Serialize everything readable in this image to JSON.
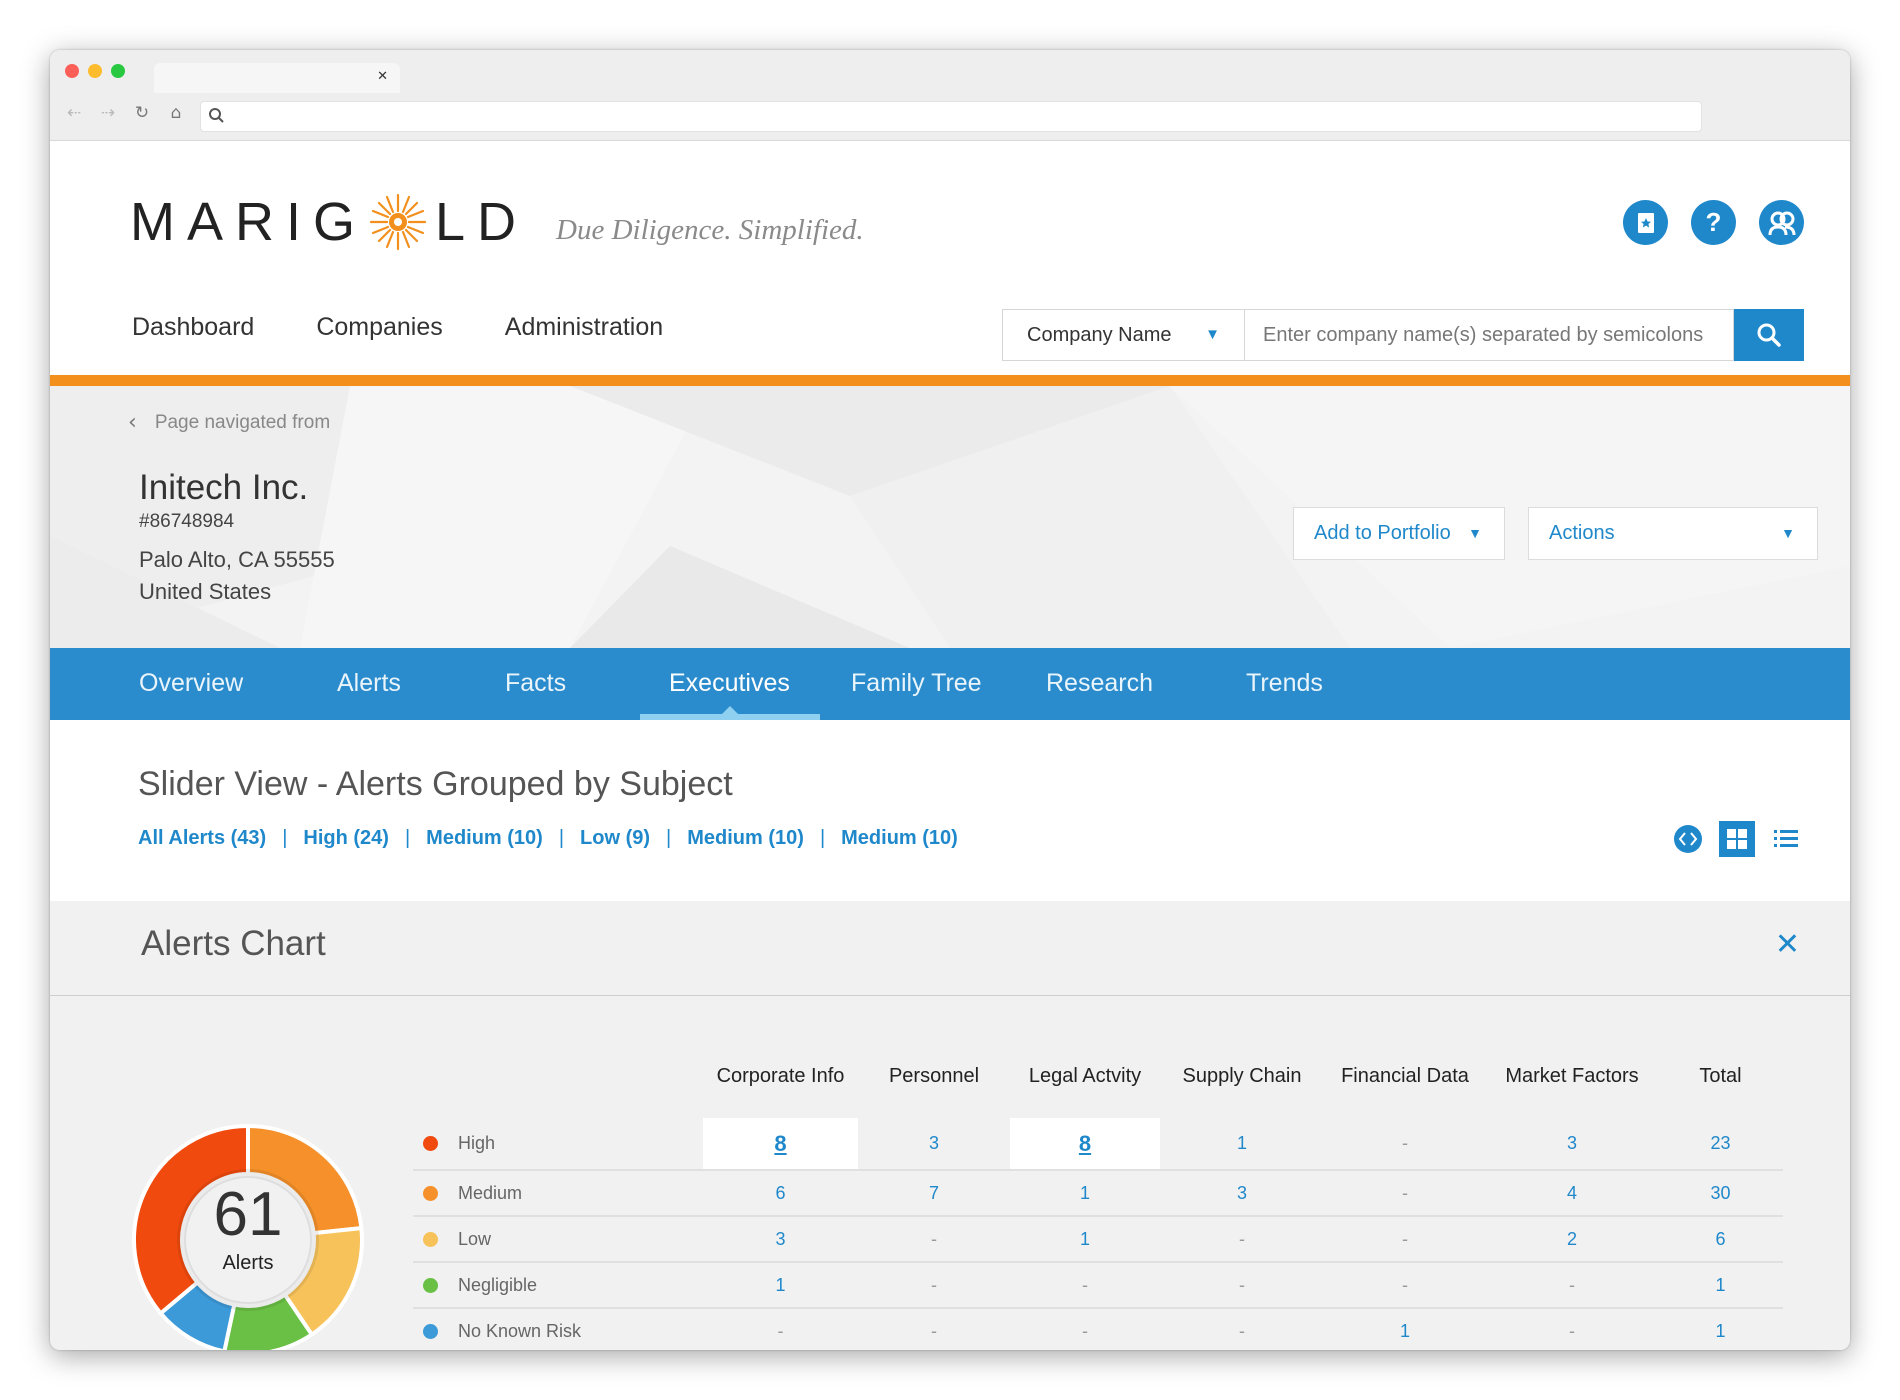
{
  "brand": {
    "logo_text_left": "MARIG",
    "logo_text_right": "LD",
    "tagline": "Due Diligence. Simplified."
  },
  "nav": [
    "Dashboard",
    "Companies",
    "Administration"
  ],
  "search": {
    "type": "Company Name",
    "placeholder": "Enter company name(s) separated by semicolons"
  },
  "company": {
    "back": "Page navigated from",
    "name": "Initech Inc.",
    "id": "#86748984",
    "address1": "Palo Alto, CA 55555",
    "address2": "United States",
    "add_portfolio": "Add to Portfolio",
    "actions": "Actions"
  },
  "tabs": [
    "Overview",
    "Alerts",
    "Facts",
    "Executives",
    "Family Tree",
    "Research",
    "Trends"
  ],
  "active_tab": "Executives",
  "section": {
    "title": "Slider View - Alerts Grouped by Subject",
    "filters": [
      "All Alerts (43)",
      "High (24)",
      "Medium (10)",
      "Low (9)",
      "Medium (10)",
      "Medium (10)"
    ]
  },
  "chart_panel": {
    "title": "Alerts Chart",
    "total": "61",
    "total_label": "Alerts"
  },
  "colors": {
    "accent": "#1f88cb",
    "brand_orange": "#f3901d",
    "high": "#f04a0e",
    "medium": "#f5902a",
    "low": "#f7c25a",
    "negligible": "#6abf45",
    "no_known_risk": "#3d9ad8"
  },
  "chart_data": {
    "type": "table",
    "columns": [
      "Corporate Info",
      "Personnel",
      "Legal Actvity",
      "Supply Chain",
      "Financial Data",
      "Market Factors",
      "Total"
    ],
    "rows": [
      {
        "name": "High",
        "values": [
          "8",
          "3",
          "8",
          "1",
          "-",
          "3",
          "23"
        ]
      },
      {
        "name": "Medium",
        "values": [
          "6",
          "7",
          "1",
          "3",
          "-",
          "4",
          "30"
        ]
      },
      {
        "name": "Low",
        "values": [
          "3",
          "-",
          "1",
          "-",
          "-",
          "2",
          "6"
        ]
      },
      {
        "name": "Negligible",
        "values": [
          "1",
          "-",
          "-",
          "-",
          "-",
          "-",
          "1"
        ]
      },
      {
        "name": "No Known Risk",
        "values": [
          "-",
          "-",
          "-",
          "-",
          "1",
          "-",
          "1"
        ]
      }
    ],
    "donut": {
      "type": "pie",
      "total": 61,
      "slices": [
        {
          "name": "High",
          "value": 23
        },
        {
          "name": "Medium",
          "value": 30
        },
        {
          "name": "Low",
          "value": 6
        },
        {
          "name": "Negligible",
          "value": 1
        },
        {
          "name": "No Known Risk",
          "value": 1
        }
      ]
    }
  }
}
